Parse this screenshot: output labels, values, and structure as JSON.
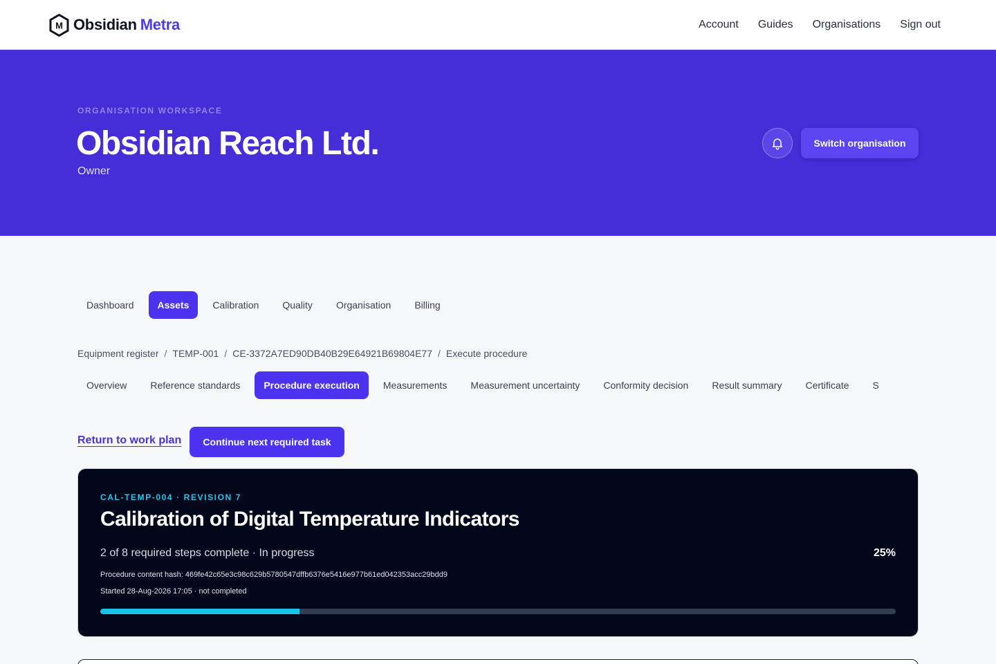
{
  "brand": {
    "name": "Obsidian",
    "accent": "Metra",
    "logo_letter": "M",
    "icon": "hexagon-m-logo-icon"
  },
  "topnav": {
    "items": [
      "Account",
      "Guides",
      "Organisations",
      "Sign out"
    ]
  },
  "hero": {
    "eyebrow": "ORGANISATION WORKSPACE",
    "title": "Obsidian Reach Ltd.",
    "role": "Owner",
    "bell_icon": "bell-icon",
    "switch_label": "Switch organisation"
  },
  "main_tabs": {
    "items": [
      "Dashboard",
      "Assets",
      "Calibration",
      "Quality",
      "Organisation",
      "Billing"
    ],
    "active": "Assets"
  },
  "breadcrumb": {
    "items": [
      "Equipment register",
      "TEMP-001",
      "CE-3372A7ED90DB40B29E64921B69804E77",
      "Execute procedure"
    ],
    "separator": "/"
  },
  "sub_tabs": {
    "items": [
      "Overview",
      "Reference standards",
      "Procedure execution",
      "Measurements",
      "Measurement uncertainty",
      "Conformity decision",
      "Result summary",
      "Certificate",
      "S"
    ],
    "active": "Procedure execution"
  },
  "actions": {
    "return_label": "Return to work plan",
    "continue_label": "Continue next required task"
  },
  "procedure": {
    "code": "CAL-TEMP-004 · REVISION 7",
    "title": "Calibration of Digital Temperature Indicators",
    "status": "2 of 8 required steps complete · In progress",
    "percent_label": "25%",
    "progress": 0.25,
    "hash_line": "Procedure content hash: 469fe42c65e3c98c629b5780547dffb6376e5416e977b61ed042353acc29bdd9",
    "started": "Started 28-Aug-2026 17:05 · not completed"
  },
  "colors": {
    "hero_bg": "#452ed8",
    "accent": "#4b33f0",
    "card_bg": "#03071a",
    "progress": "#16c3e6",
    "progress_track": "#323d52"
  }
}
